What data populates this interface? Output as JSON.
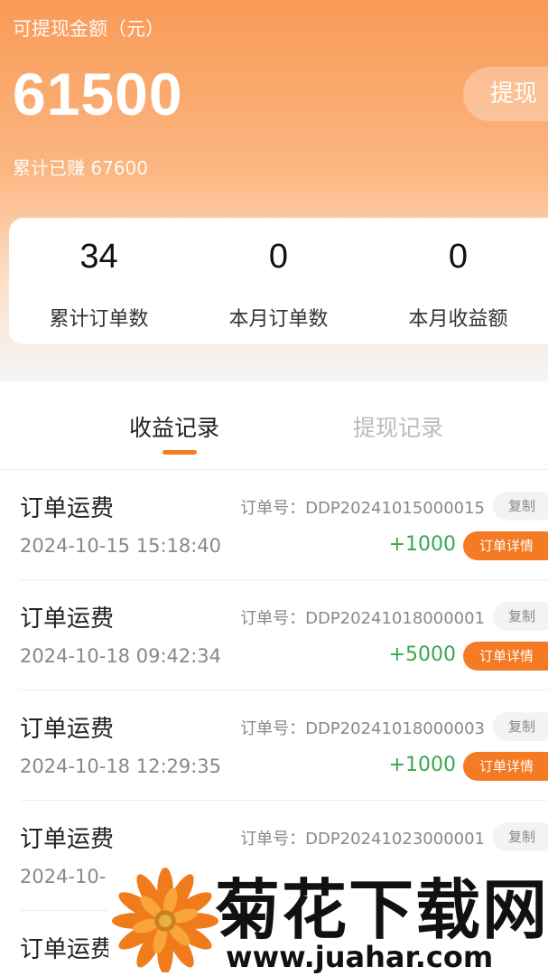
{
  "header": {
    "balance_label": "可提现金额（元）",
    "balance_amount": "61500",
    "withdraw_label": "提现",
    "total_earned": "累计已赚 67600"
  },
  "stats": [
    {
      "value": "34",
      "label": "累计订单数"
    },
    {
      "value": "0",
      "label": "本月订单数"
    },
    {
      "value": "0",
      "label": "本月收益额"
    }
  ],
  "tabs": {
    "active": "收益记录",
    "inactive": "提现记录"
  },
  "records": [
    {
      "title": "订单运费",
      "order_no": "订单号：DDP20241015000015",
      "copy": "复制",
      "time": "2024-10-15 15:18:40",
      "amount": "+1000",
      "detail": "订单详情"
    },
    {
      "title": "订单运费",
      "order_no": "订单号：DDP20241018000001",
      "copy": "复制",
      "time": "2024-10-18 09:42:34",
      "amount": "+5000",
      "detail": "订单详情"
    },
    {
      "title": "订单运费",
      "order_no": "订单号：DDP20241018000003",
      "copy": "复制",
      "time": "2024-10-18 12:29:35",
      "amount": "+1000",
      "detail": "订单详情"
    },
    {
      "title": "订单运费",
      "order_no": "订单号：DDP20241023000001",
      "copy": "复制",
      "time": "2024-10-",
      "amount": "",
      "detail": ""
    },
    {
      "title": "订单运费",
      "order_no": "",
      "copy": "",
      "time": "",
      "amount": "",
      "detail": ""
    }
  ],
  "watermark": {
    "name": "菊花下载网",
    "url": "www.juahar.com"
  },
  "colors": {
    "accent": "#f47a23",
    "positive": "#3aa653"
  }
}
